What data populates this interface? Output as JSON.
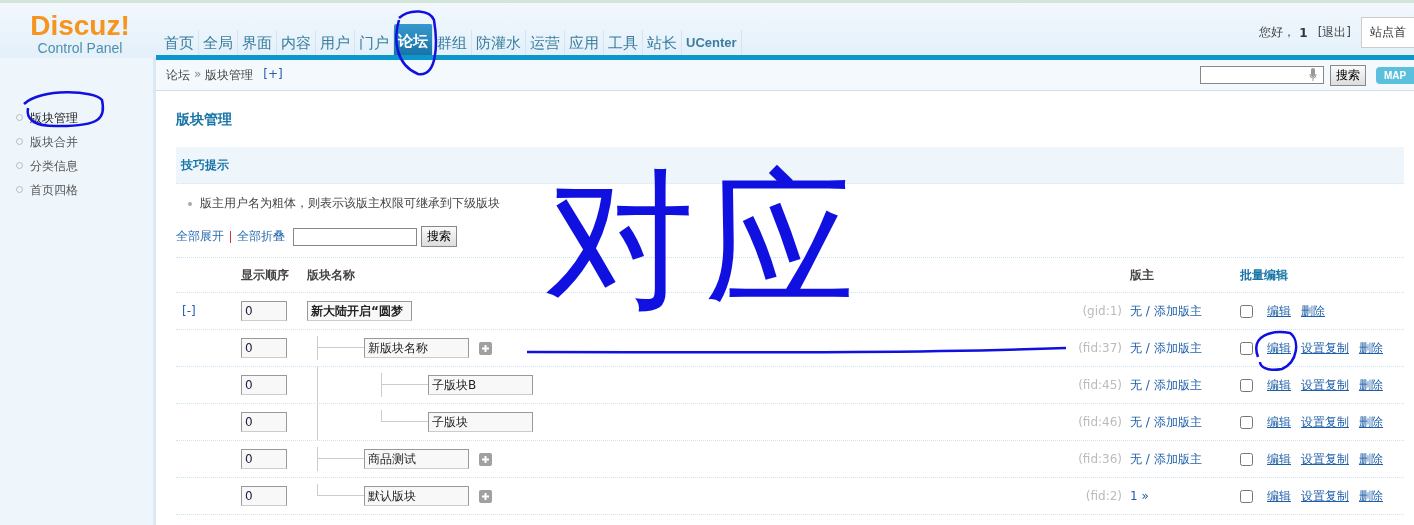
{
  "logo": {
    "name": "Discuz!",
    "subtitle": "Control Panel"
  },
  "nav": [
    {
      "label": "首页",
      "selected": false
    },
    {
      "label": "全局",
      "selected": false
    },
    {
      "label": "界面",
      "selected": false
    },
    {
      "label": "内容",
      "selected": false
    },
    {
      "label": "用户",
      "selected": false
    },
    {
      "label": "门户",
      "selected": false
    },
    {
      "label": "论坛",
      "selected": true
    },
    {
      "label": "群组",
      "selected": false
    },
    {
      "label": "防灌水",
      "selected": false
    },
    {
      "label": "运营",
      "selected": false
    },
    {
      "label": "应用",
      "selected": false
    },
    {
      "label": "工具",
      "selected": false
    },
    {
      "label": "站长",
      "selected": false
    },
    {
      "label": "UCenter",
      "selected": false
    }
  ],
  "user": {
    "greeting": "您好，",
    "name": "1",
    "logout": "[退出]",
    "site_link": "站点首"
  },
  "breadcrumb": {
    "items": [
      "论坛",
      "版块管理"
    ],
    "separator": "»",
    "add": "[+]"
  },
  "top_search": {
    "button": "搜索"
  },
  "map_button": "MAP",
  "sidebar": {
    "items": [
      {
        "label": "版块管理",
        "selected": true
      },
      {
        "label": "版块合并",
        "selected": false
      },
      {
        "label": "分类信息",
        "selected": false
      },
      {
        "label": "首页四格",
        "selected": false
      }
    ]
  },
  "page_title": "版块管理",
  "tips": {
    "title": "技巧提示",
    "items": [
      "版主用户名为粗体，则表示该版主权限可继承到下级版块"
    ]
  },
  "toolbar": {
    "expand": "全部展开",
    "collapse": "全部折叠",
    "search_button": "搜索"
  },
  "table": {
    "columns": [
      "显示顺序",
      "版块名称",
      "版主",
      "批量编辑"
    ],
    "rows": [
      {
        "toggle": "[-]",
        "order": "0",
        "name": "新大陆开启“圆梦",
        "id": "(gid:1)",
        "moderators": "无 / 添加版主",
        "checked": false,
        "actions": [
          "编辑",
          "删除"
        ],
        "children": [
          {
            "order": "0",
            "name": "新版块名称",
            "id": "(fid:37)",
            "moderators": "无 / 添加版主",
            "checked": false,
            "actions": [
              "编辑",
              "设置复制",
              "删除"
            ],
            "children": [
              {
                "order": "0",
                "name": "子版块B",
                "id": "(fid:45)",
                "moderators": "无 / 添加版主",
                "checked": false,
                "actions": [
                  "编辑",
                  "设置复制",
                  "删除"
                ]
              },
              {
                "order": "0",
                "name": "子版块",
                "id": "(fid:46)",
                "moderators": "无 / 添加版主",
                "checked": false,
                "actions": [
                  "编辑",
                  "设置复制",
                  "删除"
                ]
              }
            ]
          },
          {
            "order": "0",
            "name": "商品测试",
            "id": "(fid:36)",
            "moderators": "无 / 添加版主",
            "checked": false,
            "actions": [
              "编辑",
              "设置复制",
              "删除"
            ]
          },
          {
            "order": "0",
            "name": "默认版块",
            "id": "(fid:2)",
            "moderators": "1 »",
            "checked": false,
            "actions": [
              "编辑",
              "设置复制",
              "删除"
            ]
          }
        ]
      }
    ]
  },
  "annotation": {
    "handwritten_note": "对应"
  }
}
